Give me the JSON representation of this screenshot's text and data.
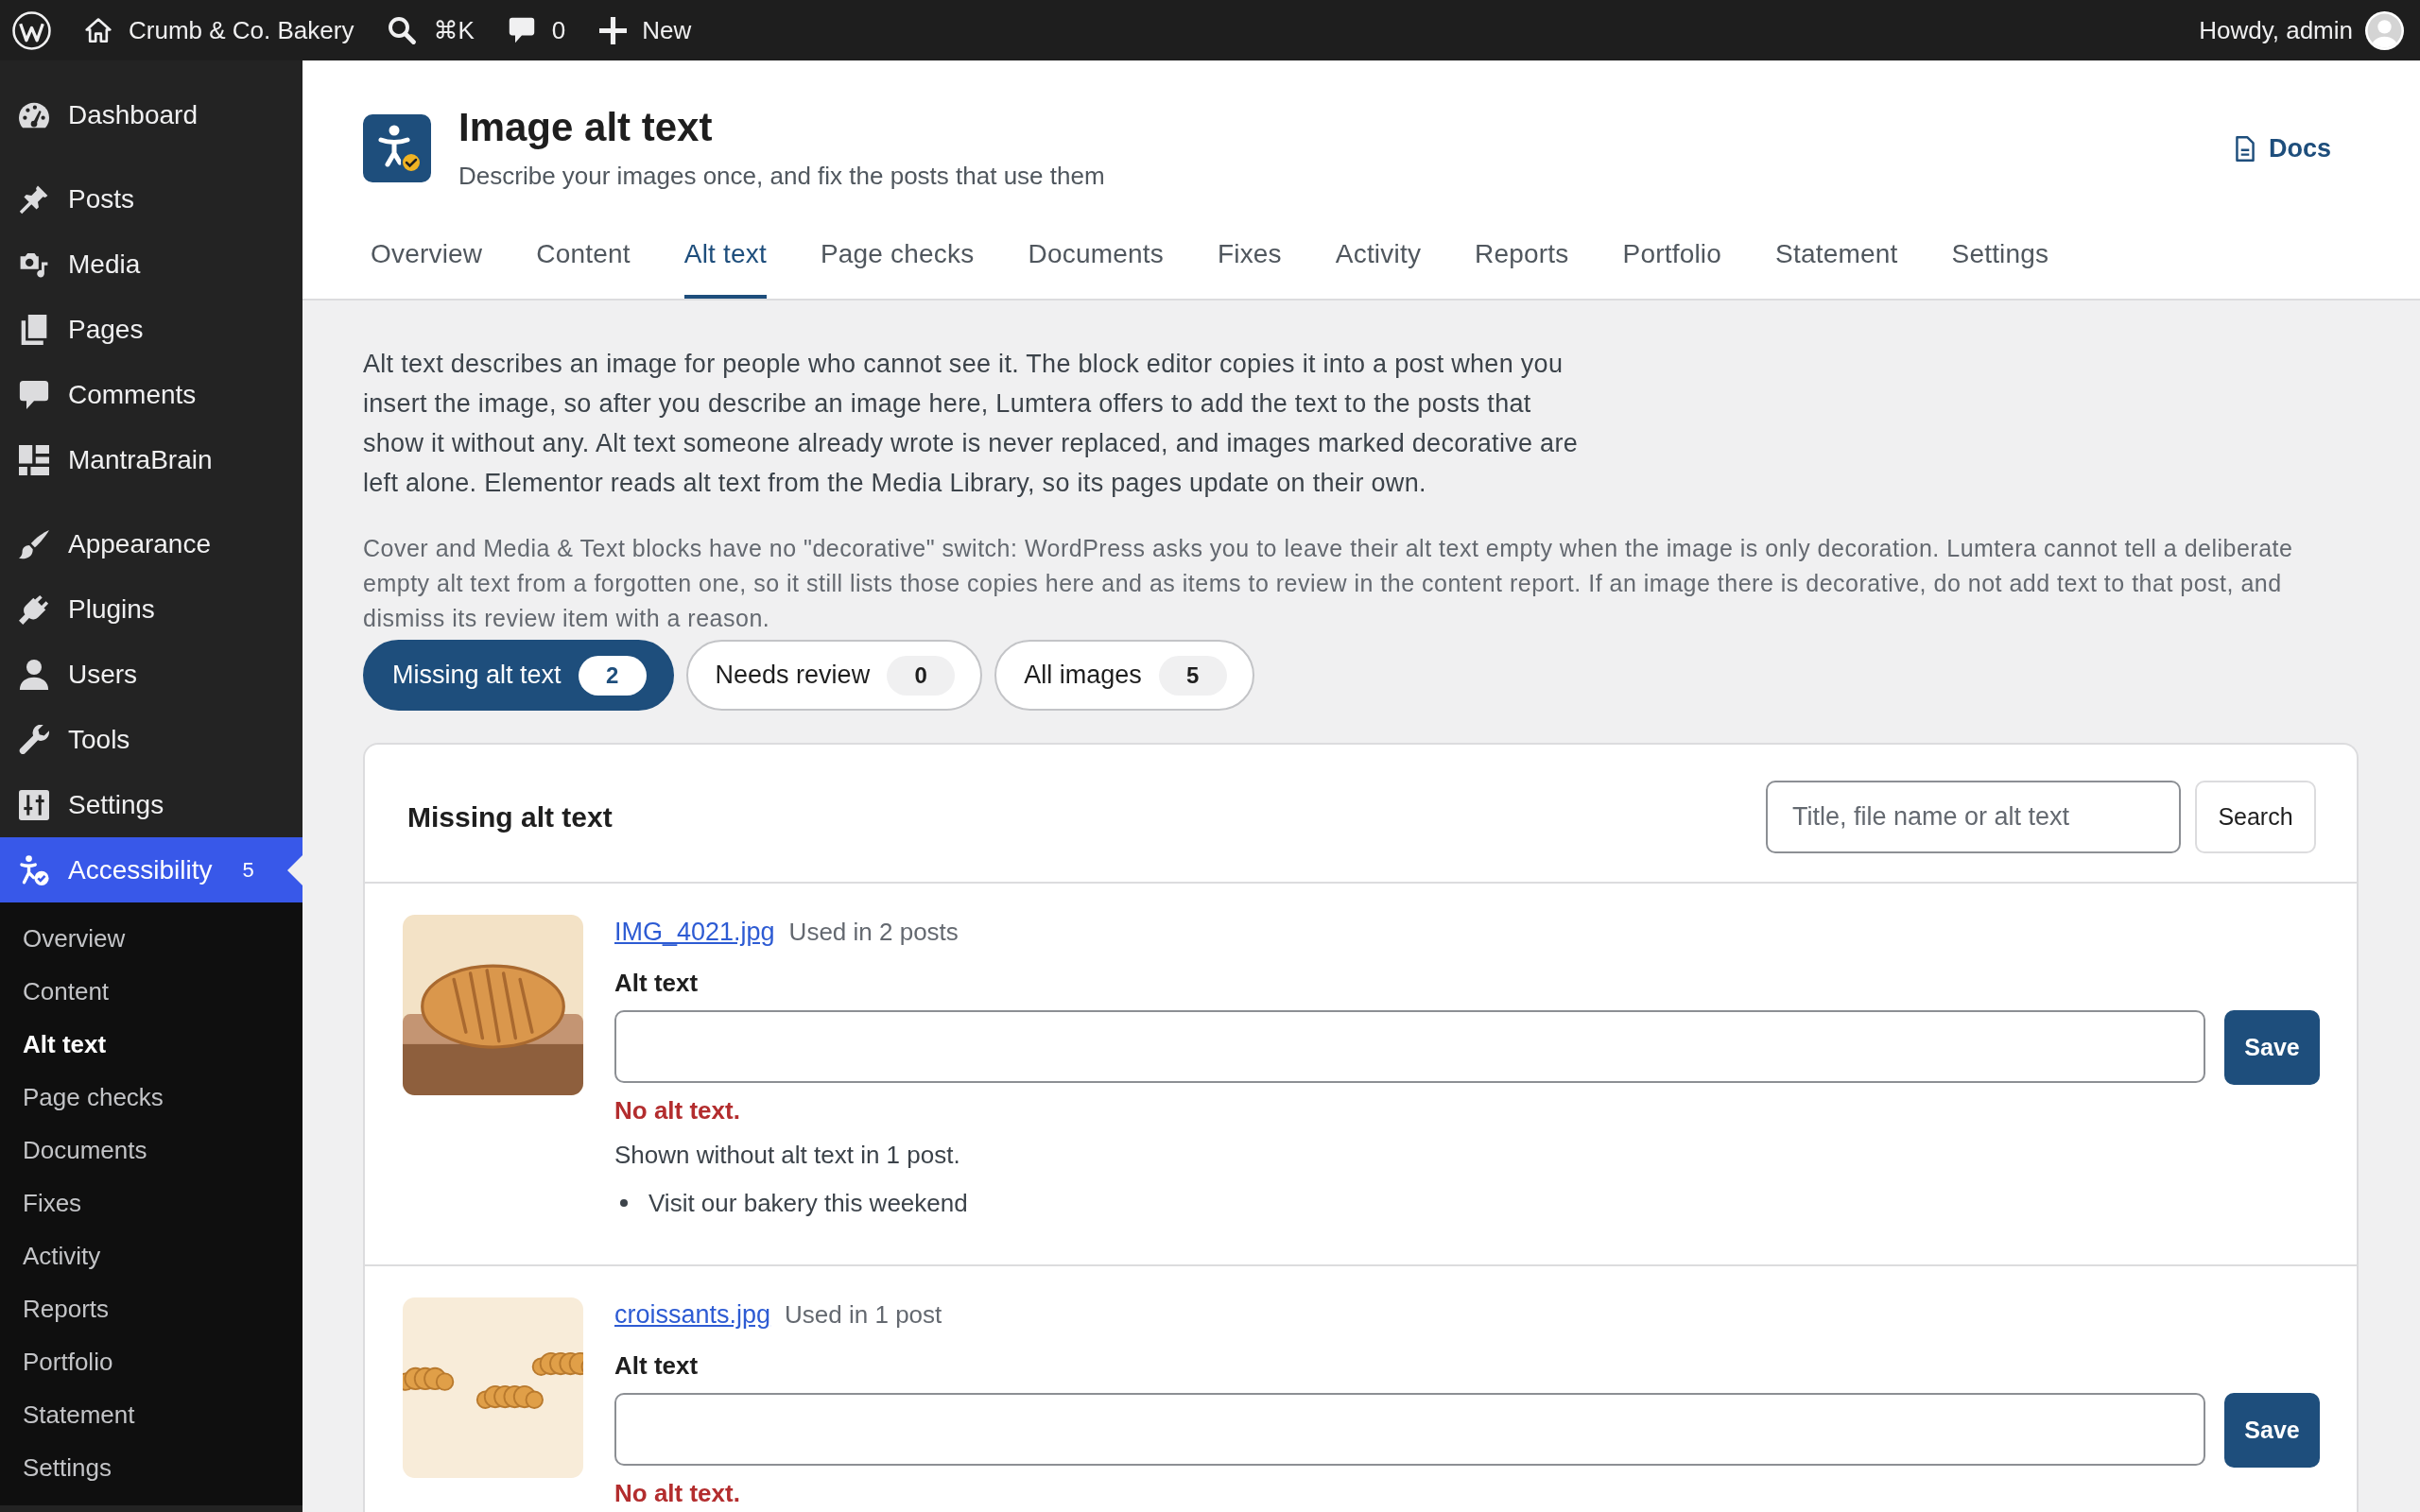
{
  "admin_bar": {
    "site_name": "Crumb & Co. Bakery",
    "search_shortcut": "⌘K",
    "comments_count": "0",
    "new_label": "New",
    "greeting": "Howdy, admin"
  },
  "sidebar": {
    "groups": [
      {
        "items": [
          {
            "label": "Dashboard",
            "selected": false
          }
        ]
      },
      {
        "items": [
          {
            "label": "Posts",
            "selected": false
          },
          {
            "label": "Media",
            "selected": false
          },
          {
            "label": "Pages",
            "selected": false
          },
          {
            "label": "Comments",
            "selected": false
          },
          {
            "label": "MantraBrain",
            "selected": false
          }
        ]
      },
      {
        "items": [
          {
            "label": "Appearance",
            "selected": false
          },
          {
            "label": "Plugins",
            "selected": false
          },
          {
            "label": "Users",
            "selected": false
          },
          {
            "label": "Tools",
            "selected": false
          },
          {
            "label": "Settings",
            "selected": false
          },
          {
            "label": "Accessibility",
            "selected": true,
            "badge": "5",
            "submenu": [
              {
                "label": "Overview",
                "selected": false
              },
              {
                "label": "Content",
                "selected": false
              },
              {
                "label": "Alt text",
                "selected": true
              },
              {
                "label": "Page checks",
                "selected": false
              },
              {
                "label": "Documents",
                "selected": false
              },
              {
                "label": "Fixes",
                "selected": false
              },
              {
                "label": "Activity",
                "selected": false
              },
              {
                "label": "Reports",
                "selected": false
              },
              {
                "label": "Portfolio",
                "selected": false
              },
              {
                "label": "Statement",
                "selected": false
              },
              {
                "label": "Settings",
                "selected": false
              }
            ]
          }
        ]
      }
    ]
  },
  "header": {
    "title": "Image alt text",
    "subtitle": "Describe your images once, and fix the posts that use them",
    "docs_label": "Docs"
  },
  "tabs": [
    {
      "label": "Overview",
      "selected": false
    },
    {
      "label": "Content",
      "selected": false
    },
    {
      "label": "Alt text",
      "selected": true
    },
    {
      "label": "Page checks",
      "selected": false
    },
    {
      "label": "Documents",
      "selected": false
    },
    {
      "label": "Fixes",
      "selected": false
    },
    {
      "label": "Activity",
      "selected": false
    },
    {
      "label": "Reports",
      "selected": false
    },
    {
      "label": "Portfolio",
      "selected": false
    },
    {
      "label": "Statement",
      "selected": false
    },
    {
      "label": "Settings",
      "selected": false
    }
  ],
  "intro": {
    "paragraph": "Alt text describes an image for people who cannot see it. The block editor copies it into a post when you insert the image, so after you describe an image here, Lumtera offers to add the text to the posts that show it without any. Alt text someone already wrote is never replaced, and images marked decorative are left alone. Elementor reads alt text from the Media Library, so its pages update on their own.",
    "note": "Cover and Media & Text blocks have no \"decorative\" switch: WordPress asks you to leave their alt text empty when the image is only decoration. Lumtera cannot tell a deliberate empty alt text from a forgotten one, so it still lists those copies here and as items to review in the content report. If an image there is decorative, do not add text to that post, and dismiss its review item with a reason."
  },
  "filters": [
    {
      "label": "Missing alt text",
      "count": "2",
      "selected": true
    },
    {
      "label": "Needs review",
      "count": "0",
      "selected": false
    },
    {
      "label": "All images",
      "count": "5",
      "selected": false
    }
  ],
  "images_panel": {
    "title": "Missing alt text",
    "search": {
      "placeholder": "Title, file name or alt text"
    },
    "search_button": "Search",
    "items": [
      {
        "file_name": "IMG_4021.jpg",
        "usage": "Used in 2 posts",
        "field_label": "Alt text",
        "save_label": "Save",
        "status": "No alt text.",
        "summary": "Shown without alt text in 1 post.",
        "posts": [
          "Visit our bakery this weekend"
        ]
      },
      {
        "file_name": "croissants.jpg",
        "usage": "Used in 1 post",
        "field_label": "Alt text",
        "save_label": "Save",
        "status": "No alt text."
      }
    ]
  }
}
